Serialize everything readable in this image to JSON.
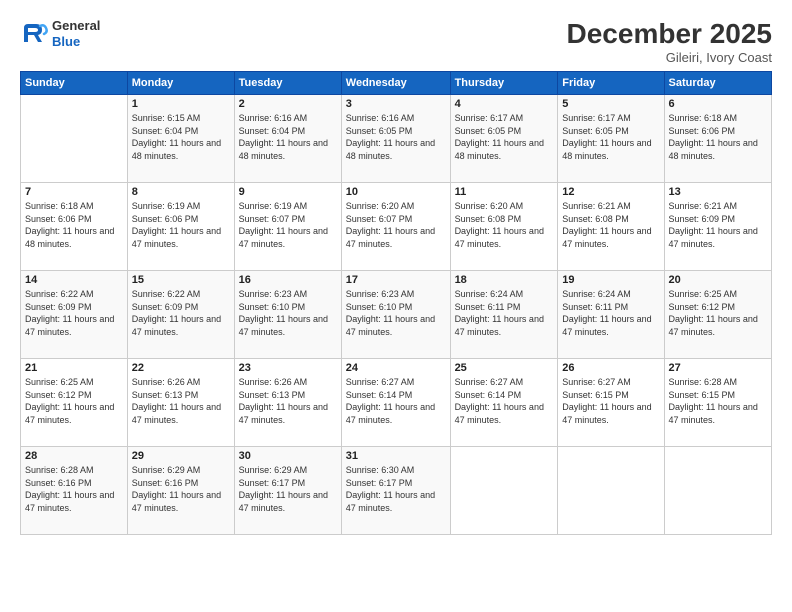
{
  "header": {
    "logo_general": "General",
    "logo_blue": "Blue",
    "month_title": "December 2025",
    "location": "Gileiri, Ivory Coast"
  },
  "days_of_week": [
    "Sunday",
    "Monday",
    "Tuesday",
    "Wednesday",
    "Thursday",
    "Friday",
    "Saturday"
  ],
  "weeks": [
    [
      {
        "day": "",
        "sunrise": "",
        "sunset": "",
        "daylight": ""
      },
      {
        "day": "1",
        "sunrise": "Sunrise: 6:15 AM",
        "sunset": "Sunset: 6:04 PM",
        "daylight": "Daylight: 11 hours and 48 minutes."
      },
      {
        "day": "2",
        "sunrise": "Sunrise: 6:16 AM",
        "sunset": "Sunset: 6:04 PM",
        "daylight": "Daylight: 11 hours and 48 minutes."
      },
      {
        "day": "3",
        "sunrise": "Sunrise: 6:16 AM",
        "sunset": "Sunset: 6:05 PM",
        "daylight": "Daylight: 11 hours and 48 minutes."
      },
      {
        "day": "4",
        "sunrise": "Sunrise: 6:17 AM",
        "sunset": "Sunset: 6:05 PM",
        "daylight": "Daylight: 11 hours and 48 minutes."
      },
      {
        "day": "5",
        "sunrise": "Sunrise: 6:17 AM",
        "sunset": "Sunset: 6:05 PM",
        "daylight": "Daylight: 11 hours and 48 minutes."
      },
      {
        "day": "6",
        "sunrise": "Sunrise: 6:18 AM",
        "sunset": "Sunset: 6:06 PM",
        "daylight": "Daylight: 11 hours and 48 minutes."
      }
    ],
    [
      {
        "day": "7",
        "sunrise": "Sunrise: 6:18 AM",
        "sunset": "Sunset: 6:06 PM",
        "daylight": "Daylight: 11 hours and 48 minutes."
      },
      {
        "day": "8",
        "sunrise": "Sunrise: 6:19 AM",
        "sunset": "Sunset: 6:06 PM",
        "daylight": "Daylight: 11 hours and 47 minutes."
      },
      {
        "day": "9",
        "sunrise": "Sunrise: 6:19 AM",
        "sunset": "Sunset: 6:07 PM",
        "daylight": "Daylight: 11 hours and 47 minutes."
      },
      {
        "day": "10",
        "sunrise": "Sunrise: 6:20 AM",
        "sunset": "Sunset: 6:07 PM",
        "daylight": "Daylight: 11 hours and 47 minutes."
      },
      {
        "day": "11",
        "sunrise": "Sunrise: 6:20 AM",
        "sunset": "Sunset: 6:08 PM",
        "daylight": "Daylight: 11 hours and 47 minutes."
      },
      {
        "day": "12",
        "sunrise": "Sunrise: 6:21 AM",
        "sunset": "Sunset: 6:08 PM",
        "daylight": "Daylight: 11 hours and 47 minutes."
      },
      {
        "day": "13",
        "sunrise": "Sunrise: 6:21 AM",
        "sunset": "Sunset: 6:09 PM",
        "daylight": "Daylight: 11 hours and 47 minutes."
      }
    ],
    [
      {
        "day": "14",
        "sunrise": "Sunrise: 6:22 AM",
        "sunset": "Sunset: 6:09 PM",
        "daylight": "Daylight: 11 hours and 47 minutes."
      },
      {
        "day": "15",
        "sunrise": "Sunrise: 6:22 AM",
        "sunset": "Sunset: 6:09 PM",
        "daylight": "Daylight: 11 hours and 47 minutes."
      },
      {
        "day": "16",
        "sunrise": "Sunrise: 6:23 AM",
        "sunset": "Sunset: 6:10 PM",
        "daylight": "Daylight: 11 hours and 47 minutes."
      },
      {
        "day": "17",
        "sunrise": "Sunrise: 6:23 AM",
        "sunset": "Sunset: 6:10 PM",
        "daylight": "Daylight: 11 hours and 47 minutes."
      },
      {
        "day": "18",
        "sunrise": "Sunrise: 6:24 AM",
        "sunset": "Sunset: 6:11 PM",
        "daylight": "Daylight: 11 hours and 47 minutes."
      },
      {
        "day": "19",
        "sunrise": "Sunrise: 6:24 AM",
        "sunset": "Sunset: 6:11 PM",
        "daylight": "Daylight: 11 hours and 47 minutes."
      },
      {
        "day": "20",
        "sunrise": "Sunrise: 6:25 AM",
        "sunset": "Sunset: 6:12 PM",
        "daylight": "Daylight: 11 hours and 47 minutes."
      }
    ],
    [
      {
        "day": "21",
        "sunrise": "Sunrise: 6:25 AM",
        "sunset": "Sunset: 6:12 PM",
        "daylight": "Daylight: 11 hours and 47 minutes."
      },
      {
        "day": "22",
        "sunrise": "Sunrise: 6:26 AM",
        "sunset": "Sunset: 6:13 PM",
        "daylight": "Daylight: 11 hours and 47 minutes."
      },
      {
        "day": "23",
        "sunrise": "Sunrise: 6:26 AM",
        "sunset": "Sunset: 6:13 PM",
        "daylight": "Daylight: 11 hours and 47 minutes."
      },
      {
        "day": "24",
        "sunrise": "Sunrise: 6:27 AM",
        "sunset": "Sunset: 6:14 PM",
        "daylight": "Daylight: 11 hours and 47 minutes."
      },
      {
        "day": "25",
        "sunrise": "Sunrise: 6:27 AM",
        "sunset": "Sunset: 6:14 PM",
        "daylight": "Daylight: 11 hours and 47 minutes."
      },
      {
        "day": "26",
        "sunrise": "Sunrise: 6:27 AM",
        "sunset": "Sunset: 6:15 PM",
        "daylight": "Daylight: 11 hours and 47 minutes."
      },
      {
        "day": "27",
        "sunrise": "Sunrise: 6:28 AM",
        "sunset": "Sunset: 6:15 PM",
        "daylight": "Daylight: 11 hours and 47 minutes."
      }
    ],
    [
      {
        "day": "28",
        "sunrise": "Sunrise: 6:28 AM",
        "sunset": "Sunset: 6:16 PM",
        "daylight": "Daylight: 11 hours and 47 minutes."
      },
      {
        "day": "29",
        "sunrise": "Sunrise: 6:29 AM",
        "sunset": "Sunset: 6:16 PM",
        "daylight": "Daylight: 11 hours and 47 minutes."
      },
      {
        "day": "30",
        "sunrise": "Sunrise: 6:29 AM",
        "sunset": "Sunset: 6:17 PM",
        "daylight": "Daylight: 11 hours and 47 minutes."
      },
      {
        "day": "31",
        "sunrise": "Sunrise: 6:30 AM",
        "sunset": "Sunset: 6:17 PM",
        "daylight": "Daylight: 11 hours and 47 minutes."
      },
      {
        "day": "",
        "sunrise": "",
        "sunset": "",
        "daylight": ""
      },
      {
        "day": "",
        "sunrise": "",
        "sunset": "",
        "daylight": ""
      },
      {
        "day": "",
        "sunrise": "",
        "sunset": "",
        "daylight": ""
      }
    ]
  ]
}
